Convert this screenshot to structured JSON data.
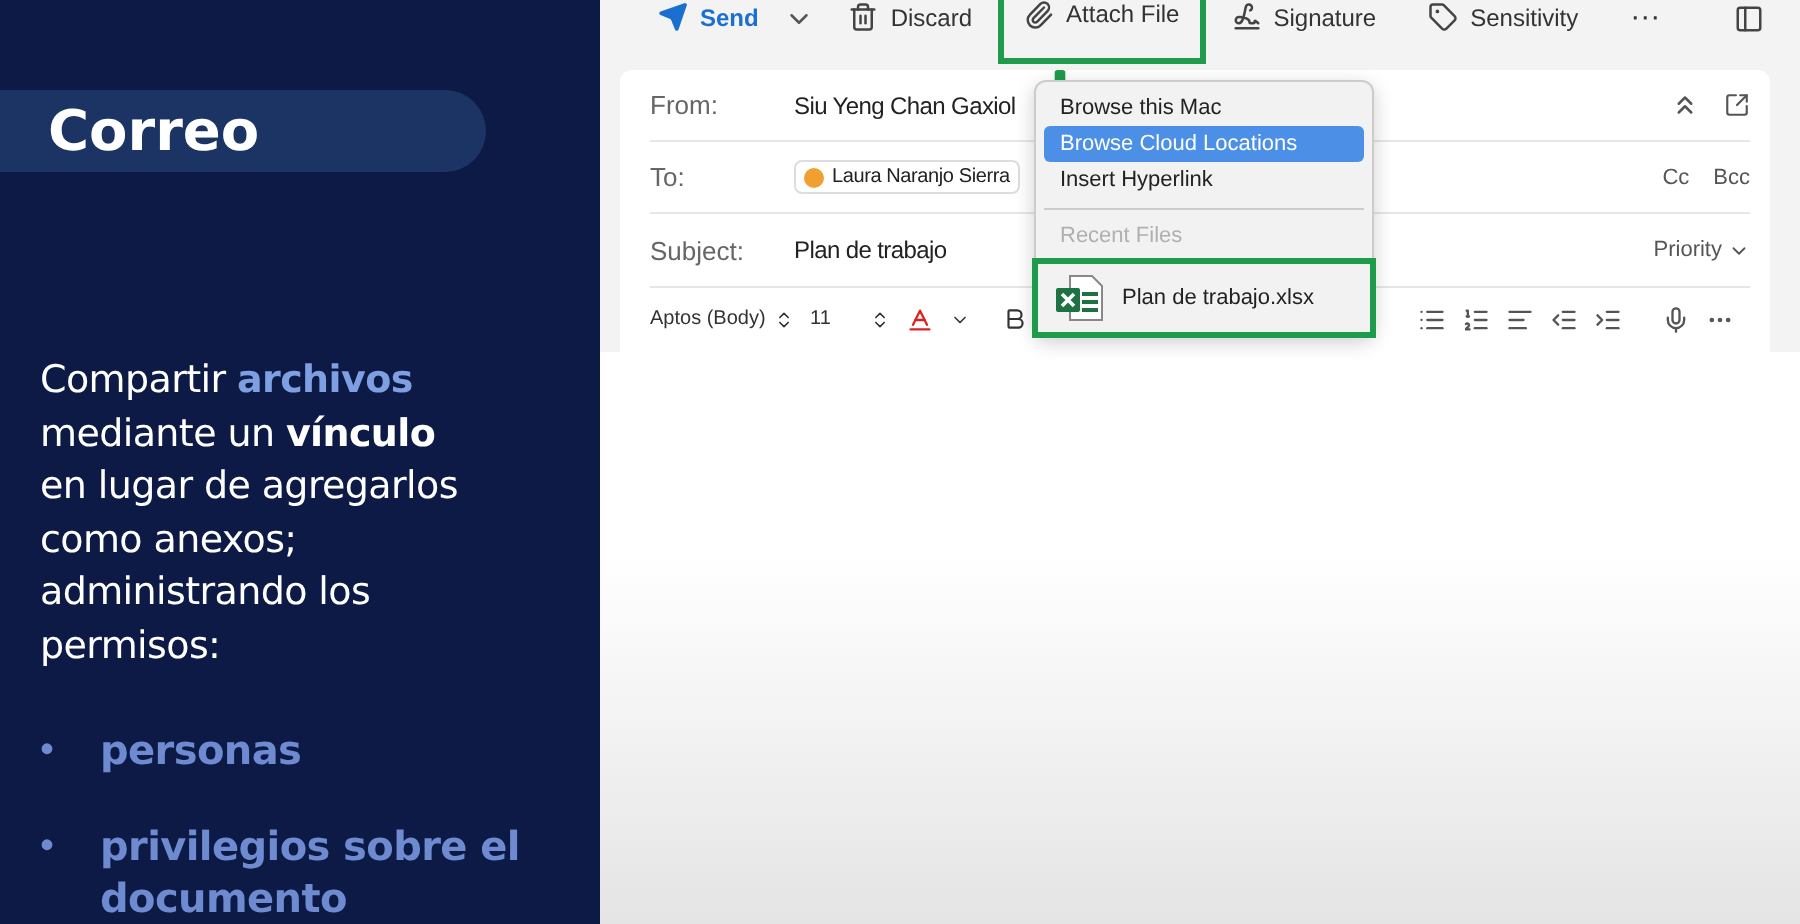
{
  "slide": {
    "title": "Correo",
    "paragraph": [
      {
        "text": "Compartir ",
        "kind": "plain"
      },
      {
        "text": "archivos",
        "kind": "accent"
      },
      {
        "text": " mediante un ",
        "kind": "plain"
      },
      {
        "text": "vínculo",
        "kind": "strong"
      },
      {
        "text": " en lugar de agregarlos como anexos; administrando los permisos:",
        "kind": "plain"
      }
    ],
    "bullets": [
      {
        "marker": "•",
        "text": "personas"
      },
      {
        "marker": "•",
        "text": "privilegios sobre el documento"
      }
    ]
  },
  "toolbar": [
    {
      "label": "Send",
      "kind": "send",
      "highlighted": false
    },
    {
      "label": "Discard",
      "kind": "discard",
      "highlighted": false
    },
    {
      "label": "Attach File",
      "kind": "attach",
      "highlighted": true
    },
    {
      "label": "Signature",
      "kind": "signature",
      "highlighted": false
    },
    {
      "label": "Sensitivity",
      "kind": "sensitivity",
      "highlighted": false
    },
    {
      "label": "···",
      "kind": "more",
      "highlighted": false
    }
  ],
  "compose": {
    "from": {
      "label": "From:",
      "value": "Siu Yeng Chan Gaxiol"
    },
    "to": {
      "label": "To:",
      "recipient": "Laura Naranjo Sierra",
      "cc": "Cc",
      "bcc": "Bcc"
    },
    "subject": {
      "label": "Subject:",
      "value": "Plan de trabajo",
      "priority": "Priority"
    },
    "format": {
      "font": "Aptos (Body)",
      "size": "11"
    }
  },
  "menu": {
    "items": [
      {
        "label": "Browse this Mac",
        "selected": false
      },
      {
        "label": "Browse Cloud Locations",
        "selected": true
      },
      {
        "label": "Insert Hyperlink",
        "selected": false
      }
    ],
    "section": "Recent Files",
    "recent": [
      {
        "label": "Plan de trabajo.xlsx",
        "highlighted": true
      }
    ]
  }
}
